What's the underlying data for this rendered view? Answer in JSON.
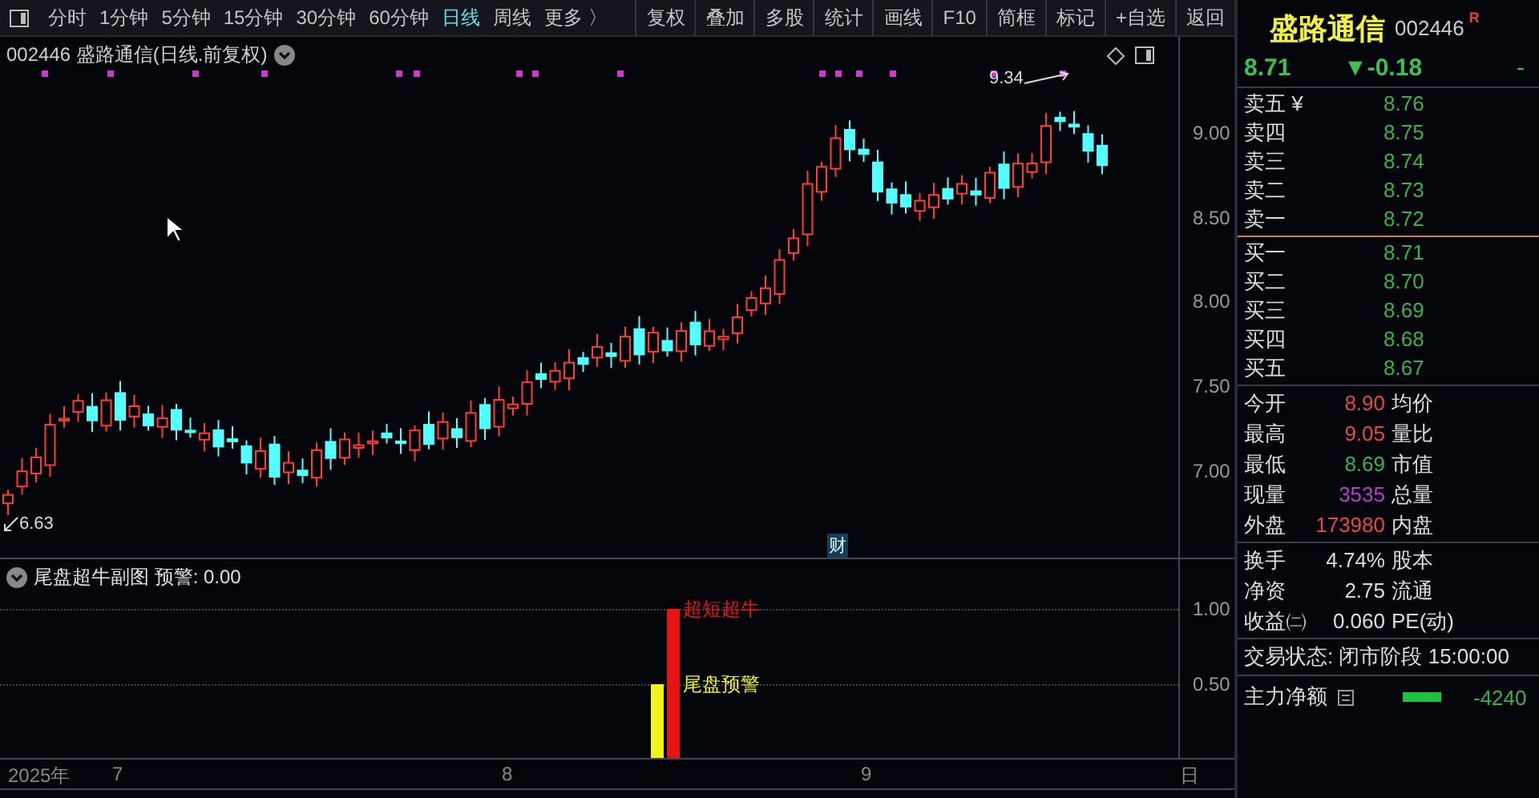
{
  "toolbar": {
    "periods": [
      {
        "label": "分时",
        "selected": false
      },
      {
        "label": "1分钟",
        "selected": false
      },
      {
        "label": "5分钟",
        "selected": false
      },
      {
        "label": "15分钟",
        "selected": false
      },
      {
        "label": "30分钟",
        "selected": false
      },
      {
        "label": "60分钟",
        "selected": false
      },
      {
        "label": "日线",
        "selected": true
      },
      {
        "label": "周线",
        "selected": false
      },
      {
        "label": "更多 〉",
        "selected": false
      }
    ],
    "buttons": [
      "复权",
      "叠加",
      "多股",
      "统计",
      "画线",
      "F10",
      "简框",
      "标记",
      "+自选",
      "返回"
    ]
  },
  "chart": {
    "title": "002446 盛路通信(日线.前复权)",
    "price_ticks": [
      "9.00",
      "8.50",
      "8.00",
      "7.50",
      "7.00"
    ],
    "high_label": "9.34",
    "low_label": "6.63",
    "event_badge": "财"
  },
  "indicator": {
    "title": "尾盘超牛副图 预警: 0.00",
    "ticks": [
      "1.00",
      "0.50"
    ],
    "signals": [
      {
        "label": "超短超牛",
        "color": "#e81414"
      },
      {
        "label": "尾盘预警",
        "color": "#f2f21e"
      }
    ]
  },
  "date_axis": [
    "2025年",
    "7",
    "8",
    "9",
    "日"
  ],
  "quote": {
    "name": "盛路通信",
    "code": "002446",
    "badge": "R",
    "price": "8.71",
    "change": "▼-0.18",
    "change_pct": "-",
    "asks": [
      {
        "label": "卖五 ¥",
        "price": "8.76"
      },
      {
        "label": "卖四",
        "price": "8.75"
      },
      {
        "label": "卖三",
        "price": "8.74"
      },
      {
        "label": "卖二",
        "price": "8.73"
      },
      {
        "label": "卖一",
        "price": "8.72"
      }
    ],
    "bids": [
      {
        "label": "买一",
        "price": "8.71"
      },
      {
        "label": "买二",
        "price": "8.70"
      },
      {
        "label": "买三",
        "price": "8.69"
      },
      {
        "label": "买四",
        "price": "8.68"
      },
      {
        "label": "买五",
        "price": "8.67"
      }
    ],
    "stats": [
      {
        "label": "今开",
        "value": "8.90",
        "color": "#e04a4a",
        "label2": "均价"
      },
      {
        "label": "最高",
        "value": "9.05",
        "color": "#e04a4a",
        "label2": "量比"
      },
      {
        "label": "最低",
        "value": "8.69",
        "color": "#3cb04a",
        "label2": "市值"
      },
      {
        "label": "现量",
        "value": "3535",
        "color": "#b040c8",
        "label2": "总量"
      },
      {
        "label": "外盘",
        "value": "173980",
        "color": "#e04a4a",
        "label2": "内盘"
      }
    ],
    "stats2": [
      {
        "label": "换手",
        "value": "4.74%",
        "label2": "股本"
      },
      {
        "label": "净资",
        "value": "2.75",
        "label2": "流通"
      },
      {
        "label": "收益㈡",
        "value": "0.060",
        "label2": "PE(动)"
      }
    ],
    "trade_state": "交易状态: 闭市阶段 15:00:00",
    "flow": {
      "label": "主力净额",
      "value": "-4240"
    }
  }
}
